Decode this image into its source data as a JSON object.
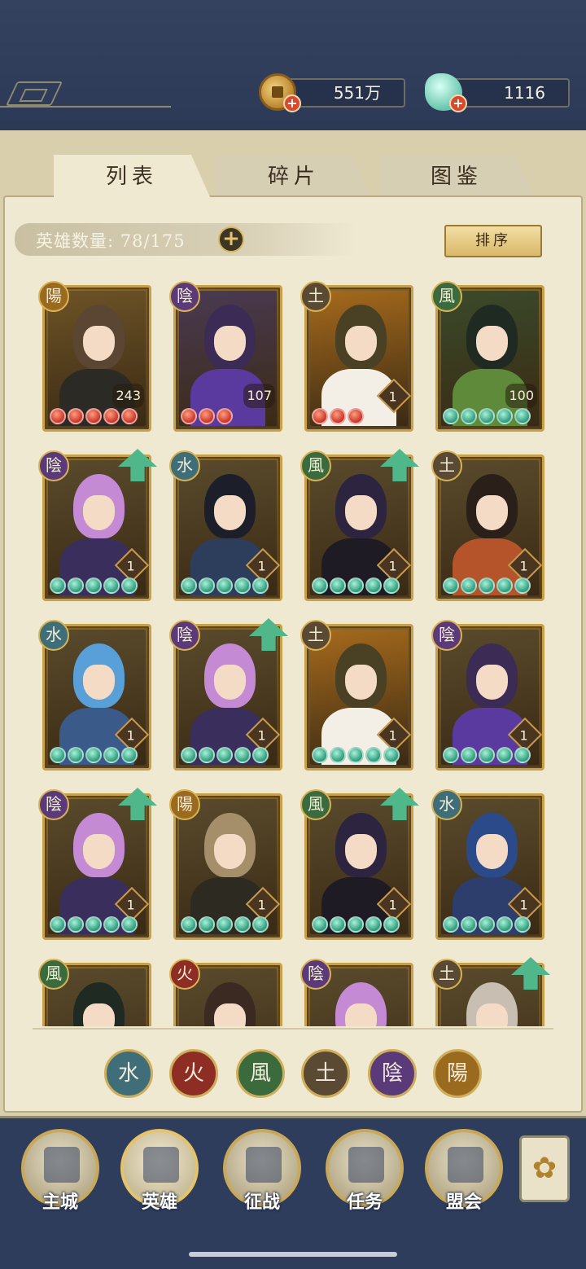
{
  "currencies": {
    "coins": "551万",
    "gems": "1116"
  },
  "tabs": [
    {
      "label": "列表",
      "active": true
    },
    {
      "label": "碎片",
      "active": false
    },
    {
      "label": "图鉴",
      "active": false
    }
  ],
  "hero_count_label": "英雄数量: 78/175",
  "sort_label": "排序",
  "element_colors": {
    "water": "#3f6e78",
    "fire": "#8e2d24",
    "wind": "#3b6b3c",
    "earth": "#5a4a34",
    "yin": "#5b3a7a",
    "yang": "#9a6b1e"
  },
  "heroes": [
    {
      "element": "陽",
      "element_key": "yang",
      "level": "243",
      "level_style": "plain",
      "stars": 5,
      "star_color": "red",
      "upgrade": false,
      "hair": "#5a4632",
      "skin_body": "#2c2a24",
      "bg": "#6d5326"
    },
    {
      "element": "陰",
      "element_key": "yin",
      "level": "107",
      "level_style": "plain",
      "stars": 3,
      "star_color": "red",
      "upgrade": false,
      "hair": "#3c2b54",
      "skin_body": "#5b3aa0",
      "bg": "#4a3a52"
    },
    {
      "element": "土",
      "element_key": "earth",
      "level": "1",
      "level_style": "diamond",
      "stars": 3,
      "star_color": "red",
      "upgrade": false,
      "hair": "#4a4024",
      "skin_body": "#f3efe7",
      "bg": "#a66a1c"
    },
    {
      "element": "風",
      "element_key": "wind",
      "level": "100",
      "level_style": "plain",
      "stars": 5,
      "star_color": "green",
      "upgrade": false,
      "hair": "#1f2a22",
      "skin_body": "#5f8a3a",
      "bg": "#3a4a2a"
    },
    {
      "element": "陰",
      "element_key": "yin",
      "level": "1",
      "level_style": "diamond",
      "stars": 5,
      "star_color": "green",
      "upgrade": true,
      "hair": "#c48ad4",
      "skin_body": "#3a2f5c",
      "bg": "#5a4a2c"
    },
    {
      "element": "水",
      "element_key": "water",
      "level": "1",
      "level_style": "diamond",
      "stars": 5,
      "star_color": "green",
      "upgrade": false,
      "hair": "#1c1f2a",
      "skin_body": "#2d3e5c",
      "bg": "#5a4a2c"
    },
    {
      "element": "風",
      "element_key": "wind",
      "level": "1",
      "level_style": "diamond",
      "stars": 5,
      "star_color": "green",
      "upgrade": true,
      "hair": "#2d2440",
      "skin_body": "#1f1b24",
      "bg": "#5a4a2c"
    },
    {
      "element": "土",
      "element_key": "earth",
      "level": "1",
      "level_style": "diamond",
      "stars": 5,
      "star_color": "green",
      "upgrade": false,
      "hair": "#2b1f1a",
      "skin_body": "#b5542a",
      "bg": "#5a4a2c"
    },
    {
      "element": "水",
      "element_key": "water",
      "level": "1",
      "level_style": "diamond",
      "stars": 5,
      "star_color": "green",
      "upgrade": false,
      "hair": "#5aa0d8",
      "skin_body": "#3a5a8a",
      "bg": "#5a4a2c"
    },
    {
      "element": "陰",
      "element_key": "yin",
      "level": "1",
      "level_style": "diamond",
      "stars": 5,
      "star_color": "green",
      "upgrade": true,
      "hair": "#c48ad4",
      "skin_body": "#3a2f5c",
      "bg": "#5a4a2c"
    },
    {
      "element": "土",
      "element_key": "earth",
      "level": "1",
      "level_style": "diamond",
      "stars": 5,
      "star_color": "green",
      "upgrade": false,
      "hair": "#4a4024",
      "skin_body": "#f3efe7",
      "bg": "#a66a1c"
    },
    {
      "element": "陰",
      "element_key": "yin",
      "level": "1",
      "level_style": "diamond",
      "stars": 5,
      "star_color": "green",
      "upgrade": false,
      "hair": "#3c2b54",
      "skin_body": "#5b3aa0",
      "bg": "#5a4a2c"
    },
    {
      "element": "陰",
      "element_key": "yin",
      "level": "1",
      "level_style": "diamond",
      "stars": 5,
      "star_color": "green",
      "upgrade": true,
      "hair": "#c48ad4",
      "skin_body": "#3a2f5c",
      "bg": "#5a4a2c"
    },
    {
      "element": "陽",
      "element_key": "yang",
      "level": "1",
      "level_style": "diamond",
      "stars": 5,
      "star_color": "green",
      "upgrade": false,
      "hair": "#a48f6a",
      "skin_body": "#2d2a22",
      "bg": "#5a4a2c"
    },
    {
      "element": "風",
      "element_key": "wind",
      "level": "1",
      "level_style": "diamond",
      "stars": 5,
      "star_color": "green",
      "upgrade": true,
      "hair": "#2d2440",
      "skin_body": "#1f1b24",
      "bg": "#5a4a2c"
    },
    {
      "element": "水",
      "element_key": "water",
      "level": "1",
      "level_style": "diamond",
      "stars": 5,
      "star_color": "green",
      "upgrade": false,
      "hair": "#2a4a8a",
      "skin_body": "#2d3e6c",
      "bg": "#5a4a2c"
    },
    {
      "element": "風",
      "element_key": "wind",
      "level": "",
      "level_style": "none",
      "stars": 0,
      "star_color": "green",
      "upgrade": false,
      "hair": "#1f2a22",
      "skin_body": "#4a5a3a",
      "bg": "#5a4a2c"
    },
    {
      "element": "火",
      "element_key": "fire",
      "level": "",
      "level_style": "none",
      "stars": 0,
      "star_color": "green",
      "upgrade": false,
      "hair": "#3a2a22",
      "skin_body": "#8e2d24",
      "bg": "#5a4a2c"
    },
    {
      "element": "陰",
      "element_key": "yin",
      "level": "",
      "level_style": "none",
      "stars": 0,
      "star_color": "green",
      "upgrade": false,
      "hair": "#c48ad4",
      "skin_body": "#3a2f5c",
      "bg": "#5a4a2c"
    },
    {
      "element": "土",
      "element_key": "earth",
      "level": "",
      "level_style": "none",
      "stars": 0,
      "star_color": "green",
      "upgrade": true,
      "hair": "#c8beb2",
      "skin_body": "#7a6a5a",
      "bg": "#5a4a2c"
    }
  ],
  "element_filters": [
    {
      "glyph": "水",
      "key": "water"
    },
    {
      "glyph": "火",
      "key": "fire"
    },
    {
      "glyph": "風",
      "key": "wind"
    },
    {
      "glyph": "土",
      "key": "earth"
    },
    {
      "glyph": "陰",
      "key": "yin"
    },
    {
      "glyph": "陽",
      "key": "yang"
    }
  ],
  "nav": [
    {
      "label": "主城",
      "icon": "castle-icon",
      "active": false
    },
    {
      "label": "英雄",
      "icon": "hero-portrait-icon",
      "active": true
    },
    {
      "label": "征战",
      "icon": "battle-drum-icon",
      "active": false
    },
    {
      "label": "任务",
      "icon": "horn-icon",
      "active": false
    },
    {
      "label": "盟会",
      "icon": "pavilion-icon",
      "active": false
    }
  ],
  "menu_icon": "flower-menu-icon"
}
